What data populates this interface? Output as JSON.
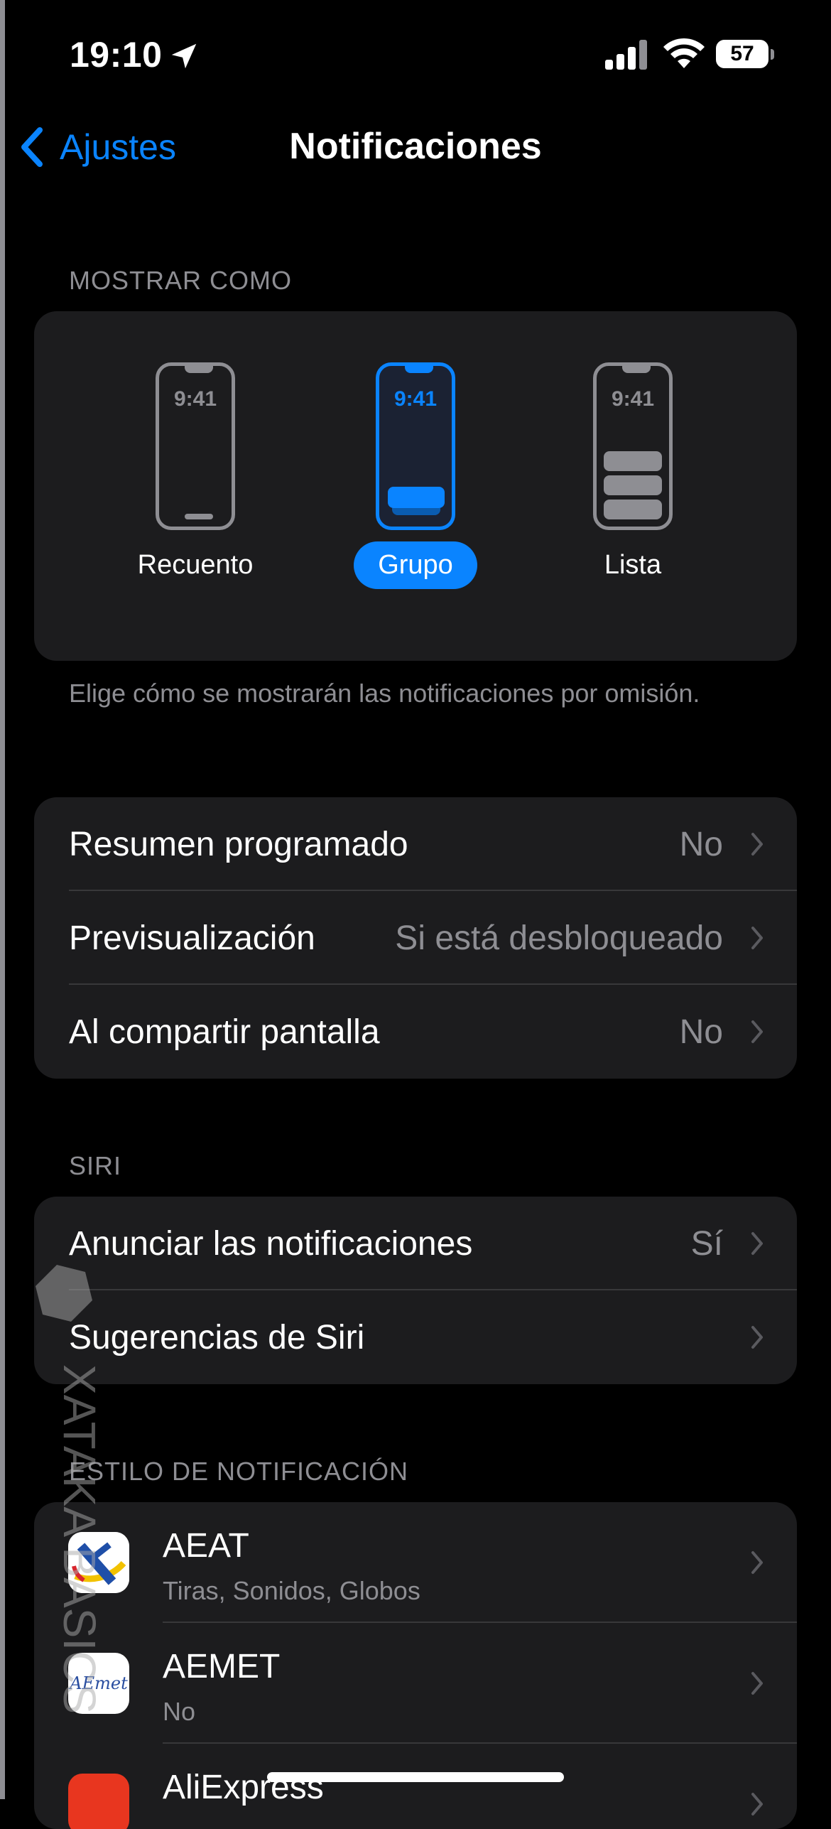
{
  "status_bar": {
    "time": "19:10",
    "battery": "57"
  },
  "nav": {
    "back_label": "Ajustes",
    "title": "Notificaciones"
  },
  "display": {
    "header": "MOSTRAR COMO",
    "options": [
      {
        "clock": "9:41",
        "label": "Recuento",
        "selected": false
      },
      {
        "clock": "9:41",
        "label": "Grupo",
        "selected": true
      },
      {
        "clock": "9:41",
        "label": "Lista",
        "selected": false
      }
    ],
    "footnote": "Elige cómo se mostrarán las notificaciones por omisión."
  },
  "general_rows": [
    {
      "label": "Resumen programado",
      "value": "No"
    },
    {
      "label": "Previsualización",
      "value": "Si está desbloqueado"
    },
    {
      "label": "Al compartir pantalla",
      "value": "No"
    }
  ],
  "siri": {
    "header": "SIRI",
    "rows": [
      {
        "label": "Anunciar las notificaciones",
        "value": "Sí"
      },
      {
        "label": "Sugerencias de Siri",
        "value": ""
      }
    ]
  },
  "style": {
    "header": "ESTILO DE NOTIFICACIÓN",
    "apps": [
      {
        "name": "AEAT",
        "sub": "Tiras, Sonidos, Globos",
        "icon": "aeat-icon"
      },
      {
        "name": "AEMET",
        "sub": "No",
        "icon": "aemet-icon",
        "icon_text": "AEmet"
      },
      {
        "name": "AliExpress",
        "sub": "",
        "icon": "aliexpress-icon"
      }
    ]
  },
  "watermark": "XATAKA BASICS",
  "colors": {
    "accent": "#0a84ff",
    "card": "#1c1c1e",
    "secondary_text": "#8e8e93"
  }
}
